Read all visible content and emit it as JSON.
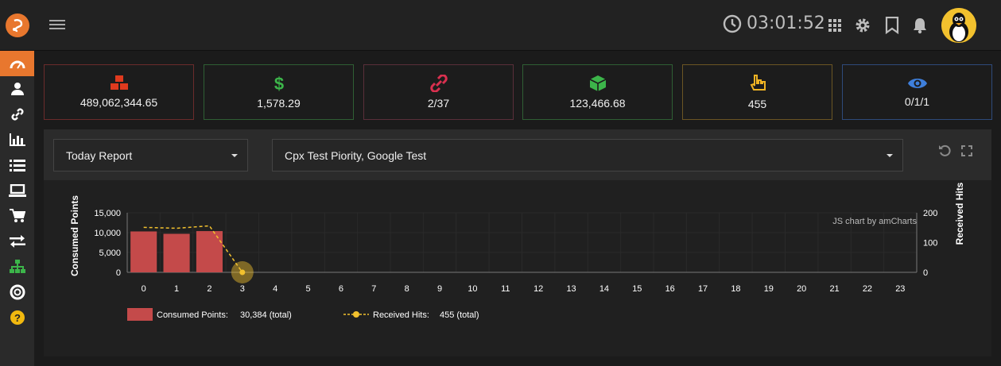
{
  "header": {
    "time": "03:01:52",
    "icons": [
      "clock-icon",
      "grid-icon",
      "gear-icon",
      "bookmark-icon",
      "bell-icon"
    ]
  },
  "sidebar": {
    "items": [
      "dashboard-icon",
      "user-icon",
      "link-icon",
      "bar-chart-icon",
      "list-icon",
      "laptop-icon",
      "cart-icon",
      "exchange-icon",
      "sitemap-icon",
      "lifebuoy-icon",
      "help-icon"
    ]
  },
  "stats": [
    {
      "value": "489,062,344.65",
      "icon": "cubes-icon",
      "color": "#e03a1e",
      "border": "#6b2b2b"
    },
    {
      "value": "1,578.29",
      "icon": "dollar-icon",
      "color": "#3cb54a",
      "border": "#2f5f34"
    },
    {
      "value": "2/37",
      "icon": "link-icon",
      "color": "#d9304f",
      "border": "#5a2f3a"
    },
    {
      "value": "123,466.68",
      "icon": "cube-icon",
      "color": "#3cb54a",
      "border": "#2f5f34"
    },
    {
      "value": "455",
      "icon": "pointer-icon",
      "color": "#f0b323",
      "border": "#6b5524"
    },
    {
      "value": "0/1/1",
      "icon": "eye-icon",
      "color": "#3e7fdc",
      "border": "#2e4a7a"
    }
  ],
  "filters": {
    "report": "Today Report",
    "campaigns": "Cpx Test Piority, Google Test"
  },
  "chart_data": {
    "type": "bar",
    "x": [
      "0",
      "1",
      "2",
      "3",
      "4",
      "5",
      "6",
      "7",
      "8",
      "9",
      "10",
      "11",
      "12",
      "13",
      "14",
      "15",
      "16",
      "17",
      "18",
      "19",
      "20",
      "21",
      "22",
      "23"
    ],
    "series": [
      {
        "name": "Consumed Points",
        "type": "bar",
        "axis": "left",
        "color": "#c44a4a",
        "values": [
          10300,
          9700,
          10384,
          0,
          null,
          null,
          null,
          null,
          null,
          null,
          null,
          null,
          null,
          null,
          null,
          null,
          null,
          null,
          null,
          null,
          null,
          null,
          null,
          null
        ]
      },
      {
        "name": "Received Hits",
        "type": "line",
        "axis": "right",
        "color": "#f2c12e",
        "values": [
          151,
          148,
          156,
          0,
          null,
          null,
          null,
          null,
          null,
          null,
          null,
          null,
          null,
          null,
          null,
          null,
          null,
          null,
          null,
          null,
          null,
          null,
          null,
          null
        ]
      }
    ],
    "ylabel_left": "Consumed Points",
    "ylabel_right": "Received Hits",
    "yticks_left": [
      "15,000",
      "10,000",
      "5,000",
      "0"
    ],
    "yticks_right": [
      "200",
      "100",
      "0"
    ],
    "ylim_left": [
      0,
      15000
    ],
    "ylim_right": [
      0,
      200
    ],
    "credit": "JS chart by amCharts",
    "legend": [
      {
        "label": "Consumed Points:",
        "total": "30,384 (total)"
      },
      {
        "label": "Received Hits:",
        "total": "455 (total)"
      }
    ]
  }
}
